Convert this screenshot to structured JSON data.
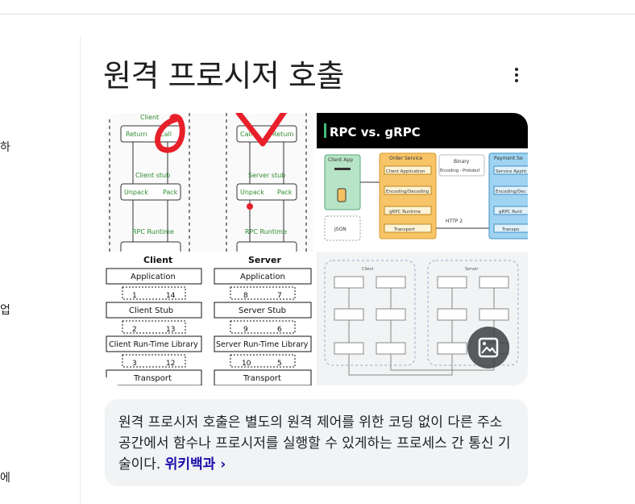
{
  "left_fragments": [
    "하",
    "업",
    "에"
  ],
  "title": "원격 프로시저 호출",
  "colors": {
    "accent_red": "#e8202a",
    "link": "#1a0dab",
    "card_bg": "#f1f3f4",
    "grpc_header": "#000000",
    "grpc_yellow": "#f7c468",
    "grpc_green": "#b7e4c7",
    "grpc_blue": "#9fd3f1"
  },
  "icons": {
    "more": "more-vert-icon",
    "image_search": "image-search-icon"
  },
  "gallery": {
    "tile1": {
      "left_header": "Client",
      "right_header": "Server",
      "left_box1": [
        "Return",
        "Call"
      ],
      "left_stub": "Client stub",
      "left_box2": [
        "Unpack",
        "Pack"
      ],
      "left_runtime": "RPC Runtime",
      "right_box1": [
        "Call",
        "Return"
      ],
      "right_stub": "Server stub",
      "right_box2": [
        "Unpack",
        "Pack"
      ],
      "right_runtime": "RPC Runtime"
    },
    "tile2": {
      "banner": "RPC vs. gRPC",
      "client_app": "Client App",
      "json": "JSON",
      "order_service": "Order Service",
      "order_items": [
        "Client Application",
        "Encoding/Decoding",
        "gRPC Runtime",
        "Transport"
      ],
      "binary": "Binary",
      "binary_sub": "Encoding - Protobuf",
      "http2": "HTTP 2",
      "payment_service": "Payment Se",
      "payment_items": [
        "Service Applic",
        "Encoding/Dec",
        "gRPC Runt",
        "Transpo"
      ]
    },
    "tile3": {
      "client": "Client",
      "server": "Server",
      "layers_left": [
        "Application",
        "Client Stub",
        "Client Run-Time Library",
        "Transport"
      ],
      "layers_right": [
        "Application",
        "Server Stub",
        "Server Run-Time Library",
        "Transport"
      ],
      "nums_left": [
        [
          "1",
          "14"
        ],
        [
          "2",
          "13"
        ],
        [
          "3",
          "12"
        ]
      ],
      "nums_right": [
        [
          "8",
          "7"
        ],
        [
          "9",
          "6"
        ],
        [
          "10",
          "5"
        ]
      ]
    },
    "tile4": {
      "client": "Client",
      "server": "Server"
    }
  },
  "description": {
    "text": "원격 프로시저 호출은 별도의 원격 제어를 위한 코딩 없이 다른 주소 공간에서 함수나 프로시저를 실행할 수 있게하는 프로세스 간 통신 기술이다. ",
    "link": "위키백과 ›"
  }
}
